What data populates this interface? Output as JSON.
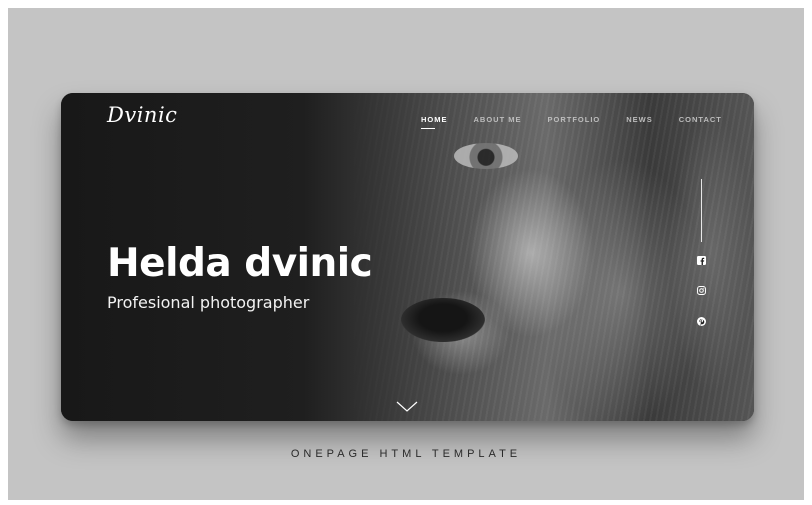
{
  "brand": {
    "logo_text": "Dvinic"
  },
  "nav": {
    "items": [
      {
        "label": "HOME",
        "active": true
      },
      {
        "label": "ABOUT ME",
        "active": false
      },
      {
        "label": "PORTFOLIO",
        "active": false
      },
      {
        "label": "NEWS",
        "active": false
      },
      {
        "label": "CONTACT",
        "active": false
      }
    ]
  },
  "hero": {
    "title": "Helda dvinic",
    "subtitle": "Profesional photographer"
  },
  "social": {
    "icons": [
      "facebook-icon",
      "instagram-icon",
      "pinterest-icon"
    ]
  },
  "caption": "ONEPAGE HTML TEMPLATE",
  "colors": {
    "background": "#c4c4c4",
    "card": "#1d1d1d",
    "text": "#ffffff",
    "caption": "#2a2a2a"
  }
}
